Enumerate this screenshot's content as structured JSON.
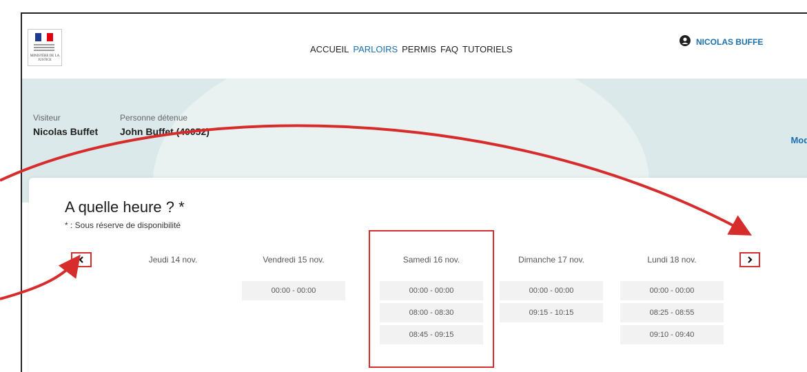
{
  "header": {
    "logo_text": "MINISTÈRE DE LA JUSTICE",
    "nav": [
      "ACCUEIL",
      "PARLOIRS",
      "PERMIS",
      "FAQ",
      "TUTORIELS"
    ],
    "active_nav": "PARLOIRS",
    "user_icon": "account-circle-icon",
    "user_name": "NICOLAS BUFFE"
  },
  "visit": {
    "visitor_label": "Visiteur",
    "visitor_name": "Nicolas Buffet",
    "detainee_label": "Personne détenue",
    "detainee_name": "John Buffet (40052)",
    "modify_label": "Modifier"
  },
  "schedule": {
    "title": "A quelle heure ? *",
    "note": "* : Sous réserve de disponibilité",
    "prev_icon": "chevron-left-icon",
    "next_icon": "chevron-right-icon",
    "days": [
      {
        "label": "Jeudi 14 nov.",
        "slots": []
      },
      {
        "label": "Vendredi 15 nov.",
        "slots": [
          "00:00 - 00:00"
        ]
      },
      {
        "label": "Samedi 16 nov.",
        "slots": [
          "00:00 - 00:00",
          "08:00 - 08:30",
          "08:45 - 09:15"
        ]
      },
      {
        "label": "Dimanche 17 nov.",
        "slots": [
          "00:00 - 00:00",
          "09:15 - 10:15"
        ]
      },
      {
        "label": "Lundi 18 nov.",
        "slots": [
          "00:00 - 00:00",
          "08:25 - 08:55",
          "09:10 - 09:40"
        ]
      }
    ]
  },
  "colors": {
    "accent": "#1b6fae",
    "annotation": "#d62c2c",
    "band": "#dbe9ea"
  }
}
